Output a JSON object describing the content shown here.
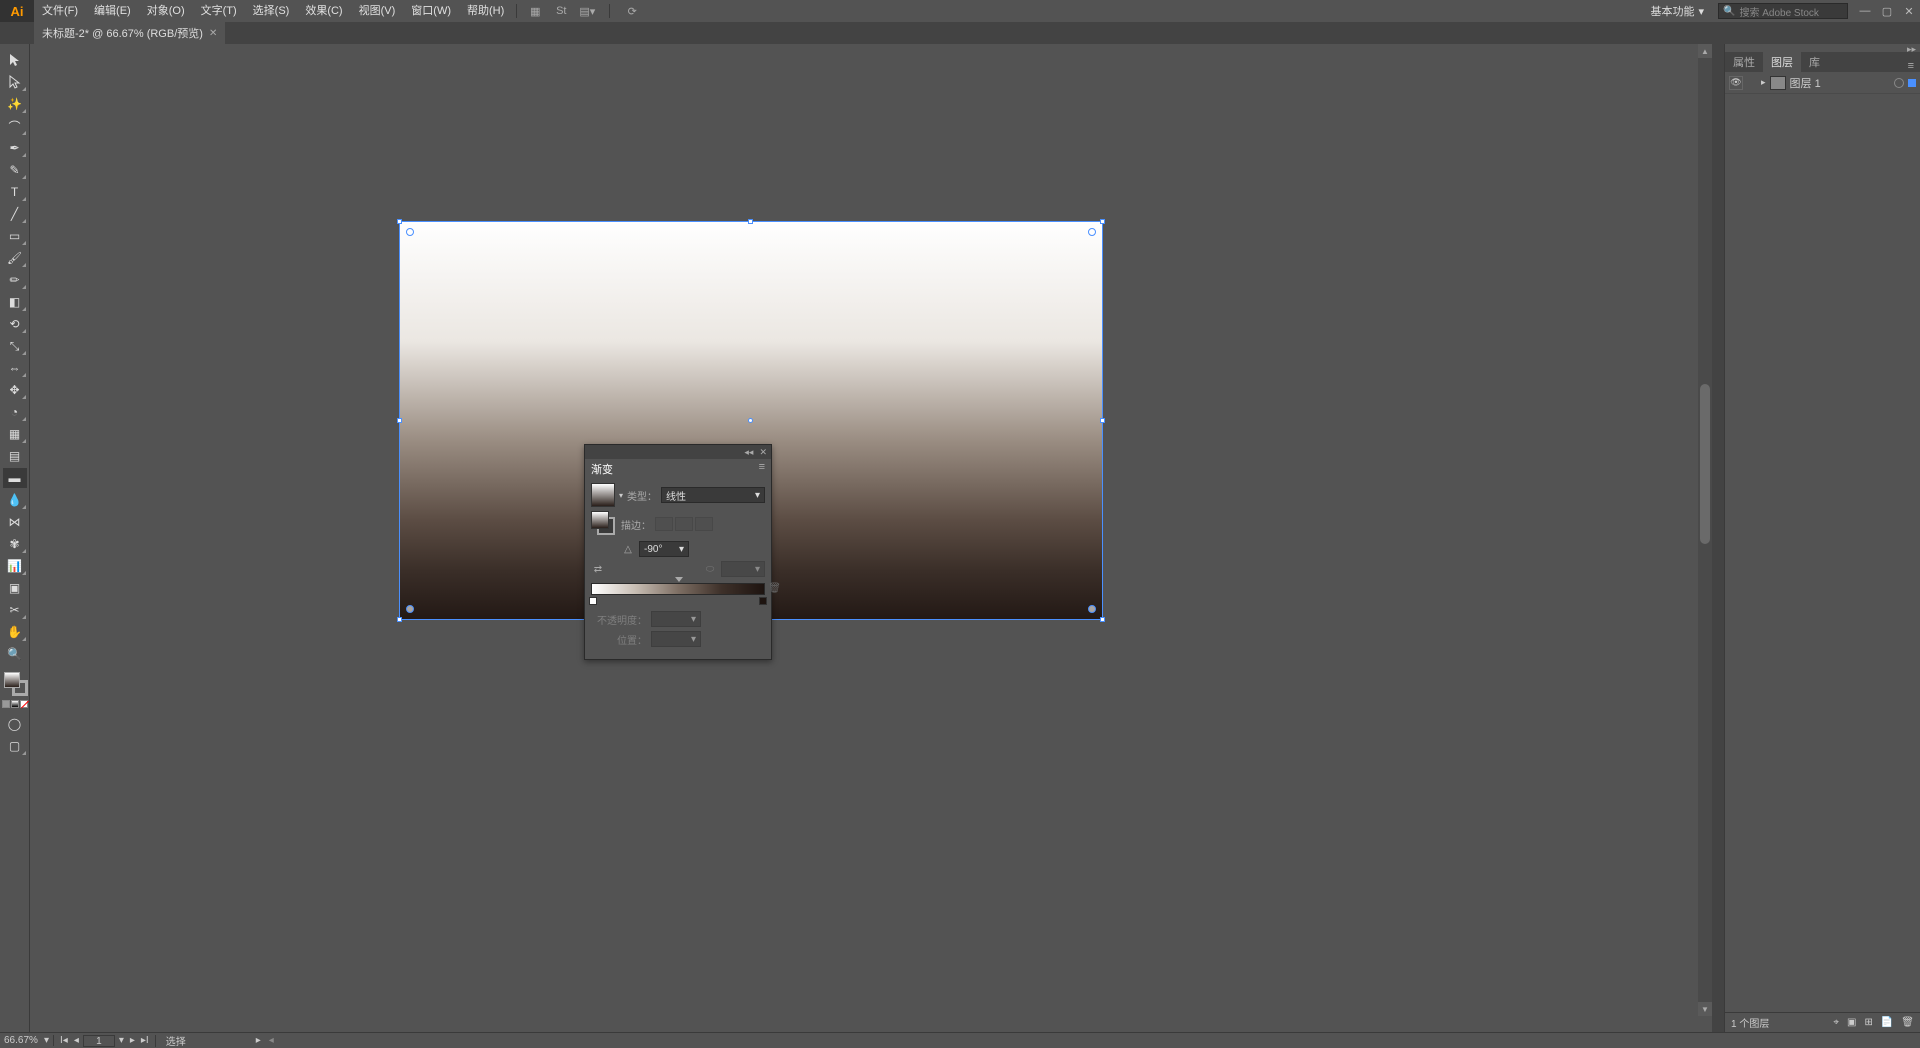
{
  "menu": {
    "file": "文件(F)",
    "edit": "编辑(E)",
    "object": "对象(O)",
    "type": "文字(T)",
    "select": "选择(S)",
    "effect": "效果(C)",
    "view": "视图(V)",
    "window": "窗口(W)",
    "help": "帮助(H)"
  },
  "workspace": "基本功能",
  "search_placeholder": "搜索 Adobe Stock",
  "doc_tab": "未标题-2* @ 66.67% (RGB/预览)",
  "gradient_panel": {
    "title": "渐变",
    "type_label": "类型：",
    "type_value": "线性",
    "stroke_label": "描边：",
    "angle_value": "-90°",
    "opacity_label": "不透明度：",
    "position_label": "位置："
  },
  "right_tabs": {
    "properties": "属性",
    "layers": "图层",
    "libraries": "库"
  },
  "layer1": "图层 1",
  "status": {
    "zoom": "66.67%",
    "artboard": "1",
    "tool": "选择",
    "layer_count": "1 个图层"
  }
}
